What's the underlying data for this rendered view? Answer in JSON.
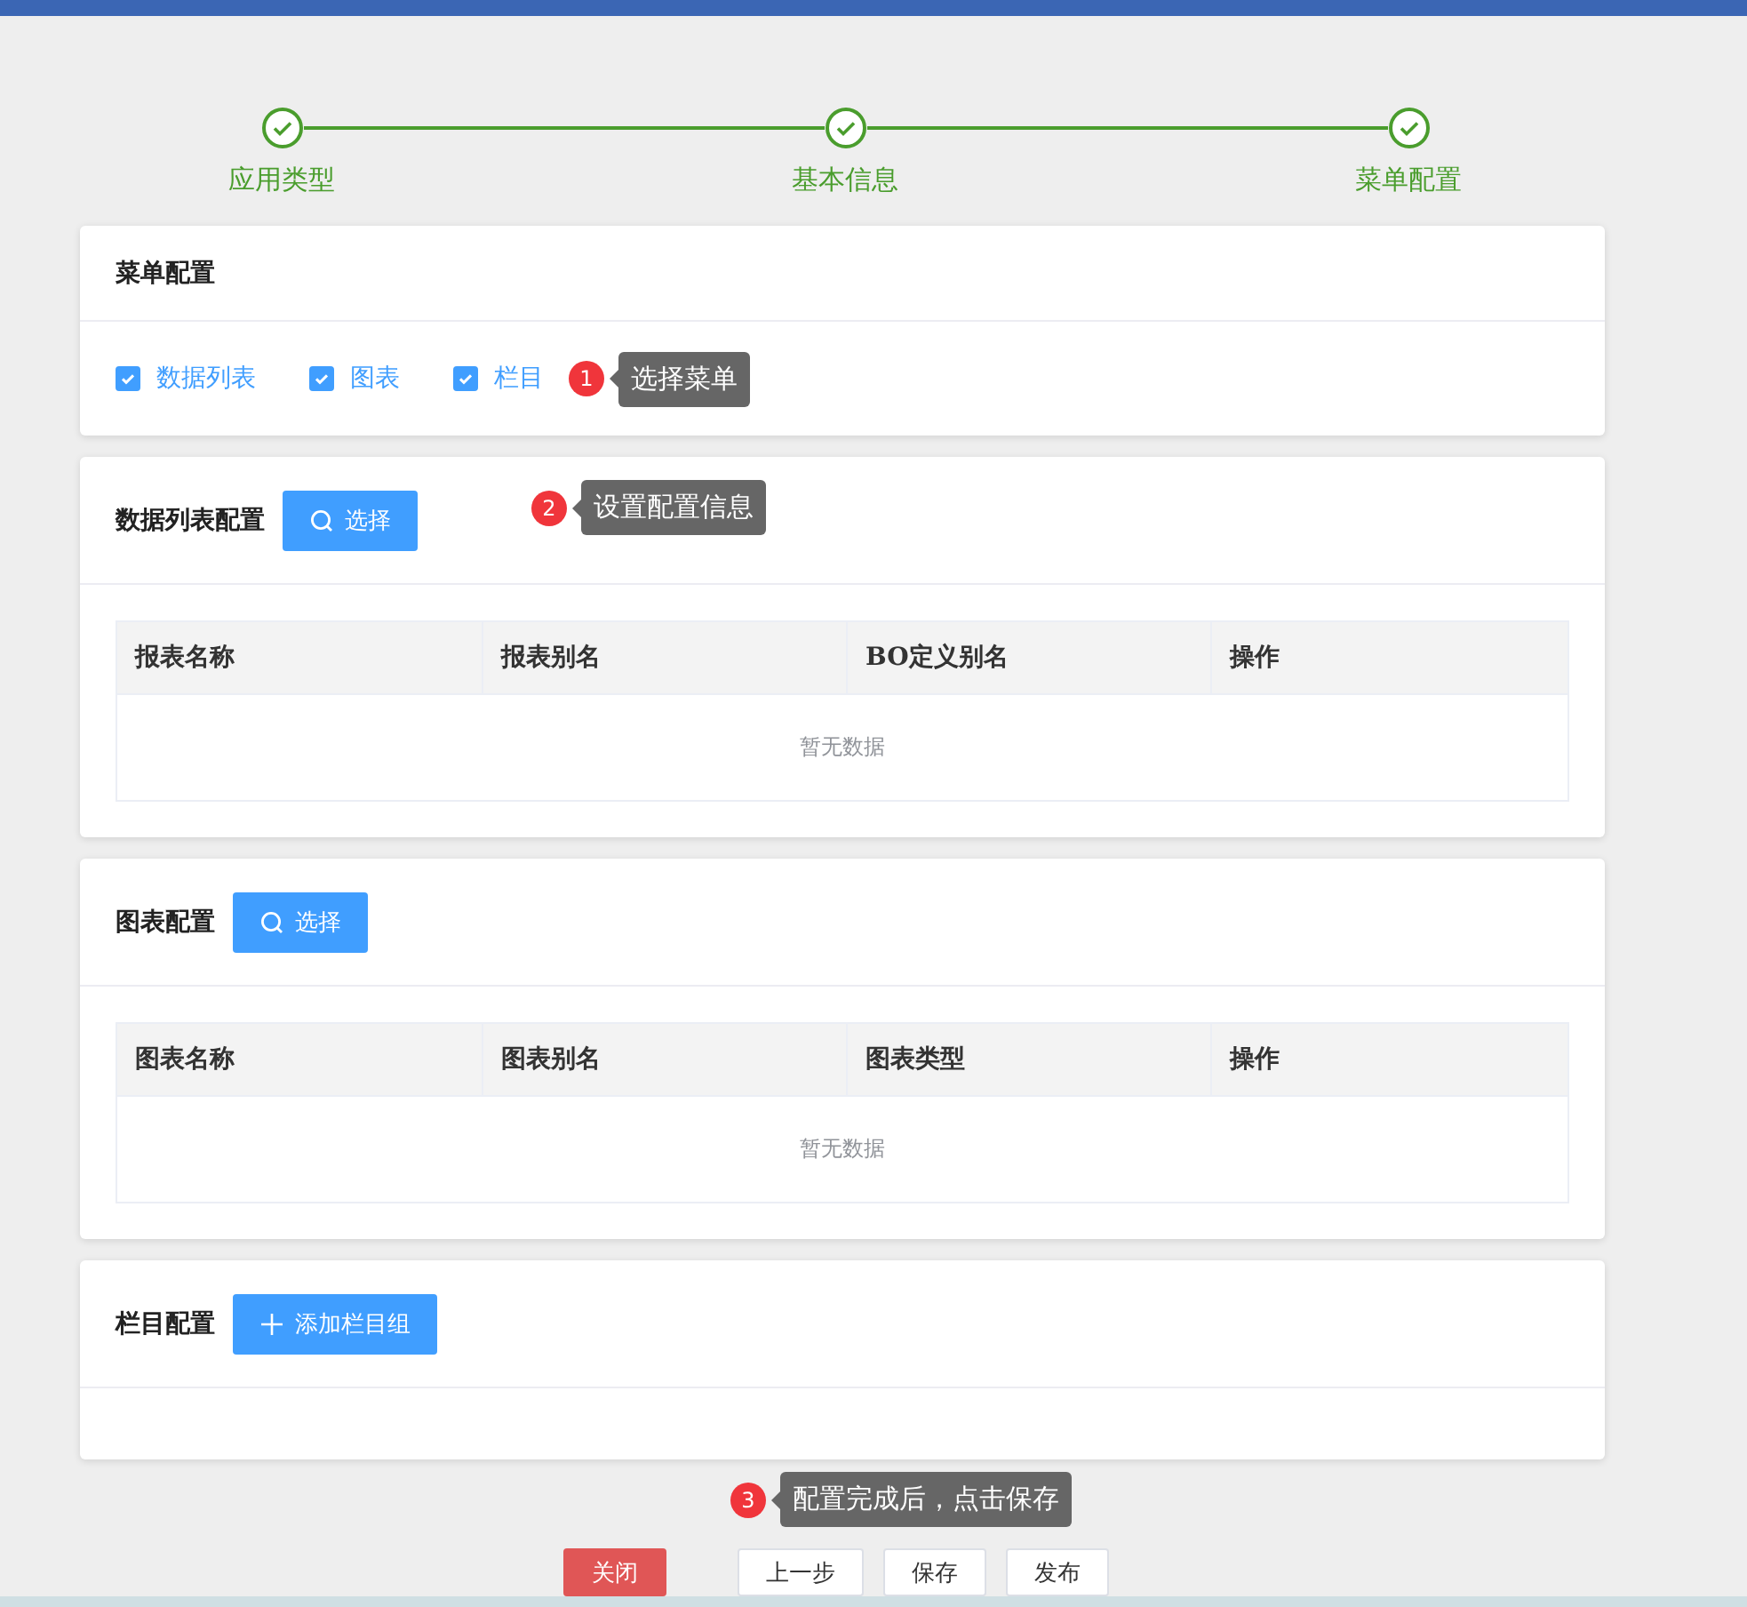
{
  "steps": [
    {
      "label": "应用类型",
      "finished": true
    },
    {
      "label": "基本信息",
      "finished": true
    },
    {
      "label": "菜单配置",
      "finished": true
    }
  ],
  "menu_card": {
    "title": "菜单配置",
    "options": [
      {
        "label": "数据列表",
        "checked": true
      },
      {
        "label": "图表",
        "checked": true
      },
      {
        "label": "栏目",
        "checked": true
      }
    ],
    "tip": {
      "number": "1",
      "text": "选择菜单"
    }
  },
  "list_card": {
    "title": "数据列表配置",
    "button": "选择",
    "tip": {
      "number": "2",
      "text": "设置配置信息"
    },
    "table": {
      "columns": [
        "报表名称",
        "报表别名",
        "BO定义别名",
        "操作"
      ],
      "empty_text": "暂无数据"
    }
  },
  "chart_card": {
    "title": "图表配置",
    "button": "选择",
    "table": {
      "columns": [
        "图表名称",
        "图表别名",
        "图表类型",
        "操作"
      ],
      "empty_text": "暂无数据"
    }
  },
  "column_card": {
    "title": "栏目配置",
    "button": "添加栏目组"
  },
  "save_tip": {
    "number": "3",
    "text": "配置完成后，点击保存"
  },
  "footer_buttons": [
    {
      "label": "关闭",
      "kind": "danger"
    },
    {
      "label": "上一步",
      "kind": "plain"
    },
    {
      "label": "保存",
      "kind": "plain"
    },
    {
      "label": "发布",
      "kind": "plain"
    }
  ]
}
